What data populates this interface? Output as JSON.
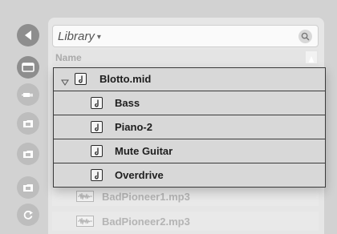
{
  "rail": {
    "items": [
      {
        "icon": "back-icon",
        "active": true
      },
      {
        "icon": "browser-icon",
        "active": true
      },
      {
        "icon": "plugin-icon",
        "active": false
      },
      {
        "icon": "folder-icon",
        "active": false
      },
      {
        "icon": "folder-icon",
        "active": false
      },
      {
        "icon": "folder-icon",
        "active": false
      },
      {
        "icon": "refresh-icon",
        "active": false
      }
    ]
  },
  "search": {
    "label": "Library",
    "caret": "▾"
  },
  "header": {
    "name_label": "Name"
  },
  "popup": {
    "parent": {
      "label": "Blotto.mid",
      "expanded": true
    },
    "children": [
      {
        "label": "Bass"
      },
      {
        "label": "Piano-2"
      },
      {
        "label": "Mute Guitar"
      },
      {
        "label": "Overdrive"
      }
    ]
  },
  "background_rows": [
    {
      "label": "BadPioneer1.mp3"
    },
    {
      "label": "BadPioneer2.mp3"
    }
  ]
}
